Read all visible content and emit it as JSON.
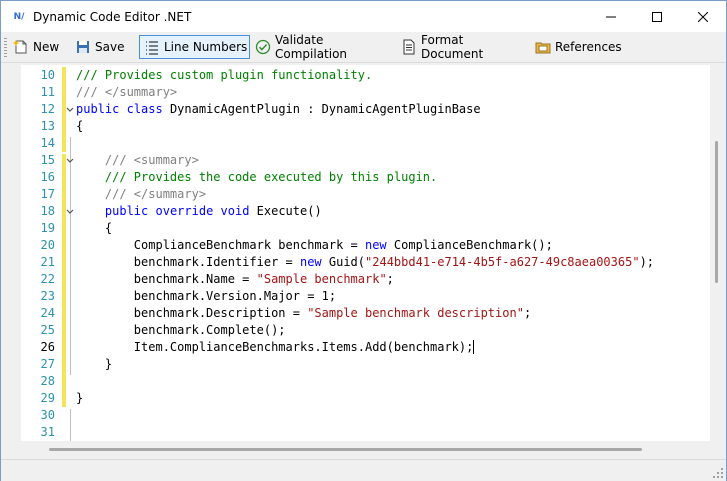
{
  "window": {
    "title": "Dynamic Code Editor .NET",
    "app_icon_text": "N/"
  },
  "toolbar": {
    "new_label": "New",
    "save_label": "Save",
    "line_numbers_label": "Line Numbers",
    "validate_label": "Validate Compilation",
    "format_label": "Format Document",
    "references_label": "References"
  },
  "editor": {
    "current_line": 26,
    "lines": [
      {
        "n": "10",
        "segs": [
          {
            "t": "/// Provides custom plugin functionality.",
            "c": "cm"
          }
        ]
      },
      {
        "n": "11",
        "segs": [
          {
            "t": "/// </summary>",
            "c": "cg"
          }
        ]
      },
      {
        "n": "12",
        "segs": [
          {
            "t": "public",
            "c": "kw"
          },
          {
            "t": " "
          },
          {
            "t": "class",
            "c": "kw"
          },
          {
            "t": " DynamicAgentPlugin : DynamicAgentPluginBase"
          }
        ]
      },
      {
        "n": "13",
        "segs": [
          {
            "t": "{"
          }
        ]
      },
      {
        "n": "14",
        "segs": []
      },
      {
        "n": "15",
        "segs": [
          {
            "t": "    "
          },
          {
            "t": "/// <summary>",
            "c": "cg"
          }
        ]
      },
      {
        "n": "16",
        "segs": [
          {
            "t": "    "
          },
          {
            "t": "/// Provides the code executed by this plugin.",
            "c": "cm"
          }
        ]
      },
      {
        "n": "17",
        "segs": [
          {
            "t": "    "
          },
          {
            "t": "/// </summary>",
            "c": "cg"
          }
        ]
      },
      {
        "n": "18",
        "segs": [
          {
            "t": "    "
          },
          {
            "t": "public",
            "c": "kw"
          },
          {
            "t": " "
          },
          {
            "t": "override",
            "c": "kw"
          },
          {
            "t": " "
          },
          {
            "t": "void",
            "c": "kw"
          },
          {
            "t": " Execute()"
          }
        ]
      },
      {
        "n": "19",
        "segs": [
          {
            "t": "    {"
          }
        ]
      },
      {
        "n": "20",
        "segs": [
          {
            "t": "        ComplianceBenchmark benchmark = "
          },
          {
            "t": "new",
            "c": "kw"
          },
          {
            "t": " ComplianceBenchmark();"
          }
        ]
      },
      {
        "n": "21",
        "segs": [
          {
            "t": "        benchmark.Identifier = "
          },
          {
            "t": "new",
            "c": "kw"
          },
          {
            "t": " Guid("
          },
          {
            "t": "\"244bbd41-e714-4b5f-a627-49c8aea00365\"",
            "c": "st"
          },
          {
            "t": ");"
          }
        ]
      },
      {
        "n": "22",
        "segs": [
          {
            "t": "        benchmark.Name = "
          },
          {
            "t": "\"Sample benchmark\"",
            "c": "st"
          },
          {
            "t": ";"
          }
        ]
      },
      {
        "n": "23",
        "segs": [
          {
            "t": "        benchmark.Version.Major = 1;"
          }
        ]
      },
      {
        "n": "24",
        "segs": [
          {
            "t": "        benchmark.Description = "
          },
          {
            "t": "\"Sample benchmark description\"",
            "c": "st"
          },
          {
            "t": ";"
          }
        ]
      },
      {
        "n": "25",
        "segs": [
          {
            "t": "        benchmark.Complete();"
          }
        ]
      },
      {
        "n": "26",
        "segs": [
          {
            "t": "        Item.ComplianceBenchmarks.Items.Add(benchmark);"
          }
        ]
      },
      {
        "n": "27",
        "segs": [
          {
            "t": "    }"
          }
        ]
      },
      {
        "n": "28",
        "segs": []
      },
      {
        "n": "29",
        "segs": [
          {
            "t": "}"
          }
        ]
      },
      {
        "n": "30",
        "segs": []
      },
      {
        "n": "31",
        "segs": []
      }
    ]
  },
  "colors": {
    "comment": "#008000",
    "doc_tag": "#808080",
    "keyword": "#0000ff",
    "string": "#a31515",
    "line_number": "#2b91af",
    "change_marker": "#f5e35a"
  },
  "icons": {
    "new": "new-document-icon",
    "save": "floppy-disk-icon",
    "line_numbers": "list-icon",
    "validate": "check-circle-icon",
    "format": "document-icon",
    "references": "folder-references-icon"
  }
}
